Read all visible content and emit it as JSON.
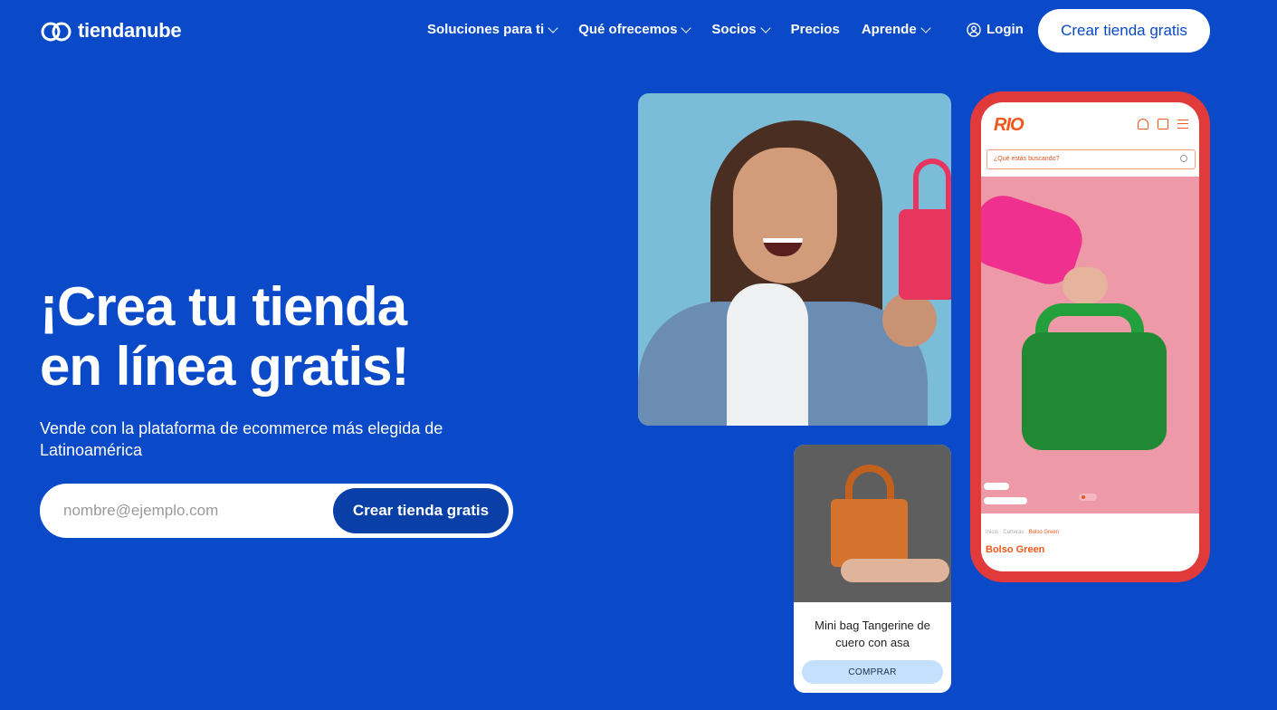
{
  "header": {
    "brand": "tiendanube",
    "nav": [
      {
        "label": "Soluciones para ti",
        "dropdown": true
      },
      {
        "label": "Qué ofrecemos",
        "dropdown": true
      },
      {
        "label": "Socios",
        "dropdown": true
      },
      {
        "label": "Precios",
        "dropdown": false
      },
      {
        "label": "Aprende",
        "dropdown": true
      }
    ],
    "login_label": "Login",
    "cta_label": "Crear tienda gratis"
  },
  "hero": {
    "title_line1": "¡Crea tu tienda",
    "title_line2": "en línea gratis!",
    "subtitle": "Vende con la plataforma de ecommerce más elegida de Latinoamérica",
    "email_placeholder": "nombre@ejemplo.com",
    "submit_label": "Crear tienda gratis"
  },
  "product_card": {
    "name": "Mini bag Tangerine de cuero con asa",
    "buy_label": "COMPRAR"
  },
  "phone": {
    "store_logo": "RIO",
    "search_placeholder": "¿Qué estás buscando?",
    "breadcrumb_home": "Inicio",
    "breadcrumb_category": "Carteras",
    "breadcrumb_current": "Bolso Green",
    "product_name": "Bolso Green"
  },
  "colors": {
    "background": "#0a4ac8",
    "accent_orange": "#f1571b",
    "phone_frame": "#e03a3a",
    "buy_button": "#c5e0fc"
  }
}
